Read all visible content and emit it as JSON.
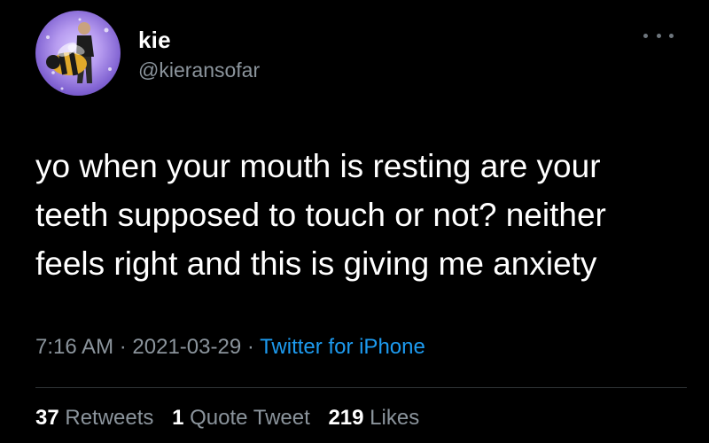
{
  "tweet": {
    "author": {
      "name": "kie",
      "handle": "@kieransofar",
      "avatar": "profile-photo-bee-icon"
    },
    "menu_icon": "more-horizontal-icon",
    "text": "yo when your mouth is resting are your\nteeth supposed to touch or not? neither\nfeels right and this is giving me anxiety",
    "time": "7:16 AM",
    "separator": "·",
    "date": "2021-03-29",
    "source": "Twitter for iPhone",
    "stats": {
      "retweets_count": "37",
      "retweets_label": "Retweets",
      "quotes_count": "1",
      "quotes_label": "Quote Tweet",
      "likes_count": "219",
      "likes_label": "Likes"
    }
  },
  "colors": {
    "background": "#000000",
    "primary_text": "#ffffff",
    "secondary_text": "#8b949c",
    "link": "#1d9bf0",
    "divider": "#2f3336"
  }
}
